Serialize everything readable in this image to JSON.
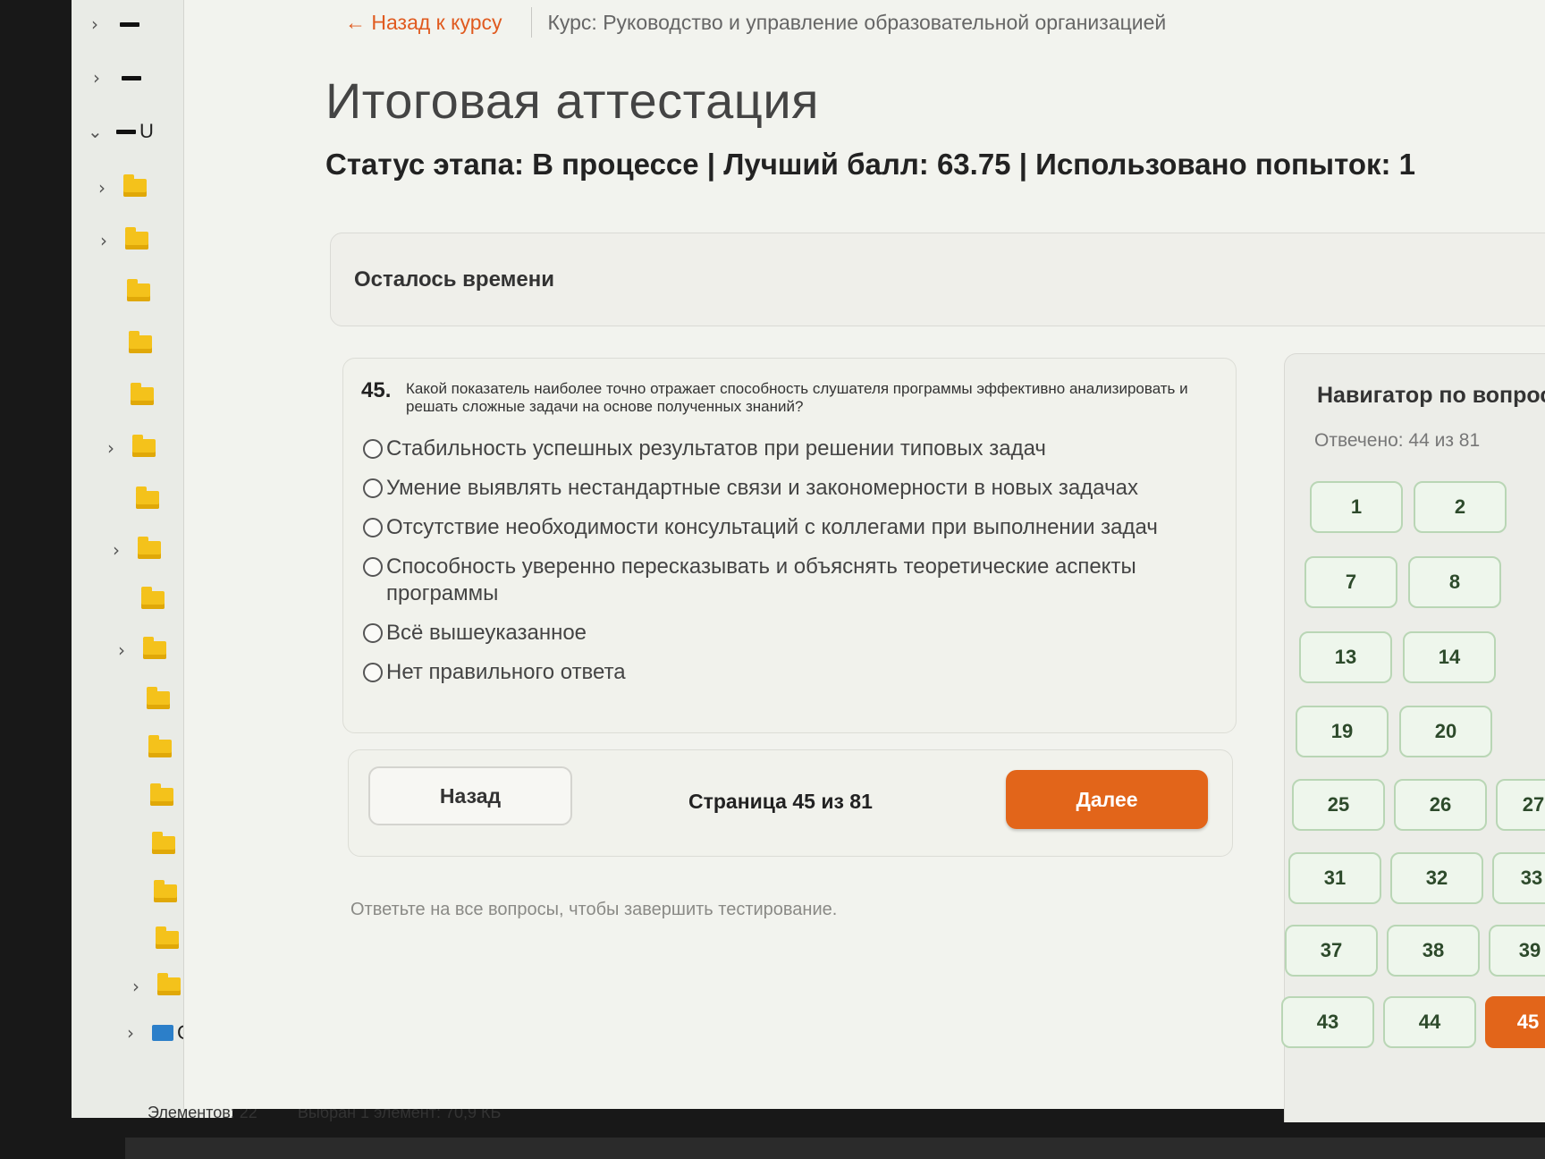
{
  "explorer": {
    "status_items": "Элементов: 22",
    "status_selected": "Выбран 1 элемент: 70,9 КБ",
    "tree_partial_label_u": "U",
    "tree_partial_label_c": "C"
  },
  "header": {
    "back_link": "← Назад к курсу",
    "course": "Курс: Руководство и управление образовательной организацией"
  },
  "page": {
    "title": "Итоговая аттестация",
    "status_line": "Статус этапа: В процессе | Лучший балл: 63.75 | Использовано попыток: 1"
  },
  "timer": {
    "label": "Осталось времени"
  },
  "question": {
    "number": "45.",
    "text": "Какой показатель наиболее точно отражает способность слушателя программы эффективно анализировать и решать сложные задачи на основе полученных знаний?",
    "options": [
      "Стабильность успешных результатов при решении типовых задач",
      "Умение выявлять нестандартные связи и закономерности в новых задачах",
      "Отсутствие необходимости консультаций с коллегами при выполнении задач",
      "Способность уверенно пересказывать и объяснять теоретические аспекты программы",
      "Всё вышеуказанное",
      "Нет правильного ответа"
    ]
  },
  "navigation": {
    "back_label": "Назад",
    "page_indicator": "Страница 45 из 81",
    "next_label": "Далее"
  },
  "hint": "Ответьте на все вопросы, чтобы завершить тестирование.",
  "navigator": {
    "title": "Навигатор по вопросам",
    "answered": "Отвечено: 44 из 81",
    "buttons": [
      "1",
      "2",
      "7",
      "8",
      "13",
      "14",
      "19",
      "20",
      "25",
      "26",
      "27",
      "31",
      "32",
      "33",
      "37",
      "38",
      "39",
      "43",
      "44",
      "45"
    ],
    "current": "45",
    "accent_color": "#e2651a",
    "answered_color": "#eef6ec"
  }
}
